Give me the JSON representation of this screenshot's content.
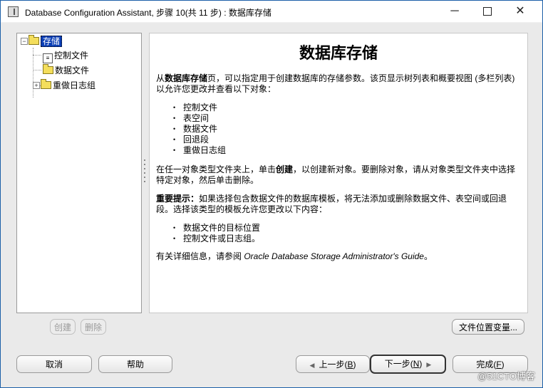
{
  "window": {
    "title": "Database Configuration Assistant, 步骤 10(共 11 步) : 数据库存储",
    "minimize_glyph": "─",
    "close_glyph": "✕"
  },
  "tree": {
    "root": "存储",
    "items": [
      "控制文件",
      "数据文件",
      "重做日志组"
    ]
  },
  "info": {
    "heading": "数据库存储",
    "p1_prefix": "从",
    "p1_bold": "数据库存储",
    "p1_rest": "页，可以指定用于创建数据库的存储参数。该页显示树列表和概要视图 (多栏列表) 以允许您更改并查看以下对象：",
    "list1": [
      "控制文件",
      "表空间",
      "数据文件",
      "回退段",
      "重做日志组"
    ],
    "p2_prefix": "在任一对象类型文件夹上，单击",
    "p2_bold": "创建",
    "p2_rest": "，以创建新对象。要删除对象，请从对象类型文件夹中选择特定对象，然后单击删除。",
    "p3_bold": "重要提示：",
    "p3_rest": "如果选择包含数据文件的数据库模板，将无法添加或删除数据文件、表空间或回退段。选择该类型的模板允许您更改以下内容：",
    "list2": [
      "数据文件的目标位置",
      "控制文件或日志组。"
    ],
    "p4_prefix": "有关详细信息，请参阅 ",
    "p4_italic": "Oracle Database Storage Administrator's Guide",
    "p4_suffix": "。"
  },
  "buttons": {
    "create": "创建",
    "delete": "删除",
    "file_location_vars": "文件位置变量...",
    "cancel": "取消",
    "help": "帮助",
    "back": "上一步",
    "back_key": "B",
    "next": "下一步",
    "next_key": "N",
    "finish": "完成",
    "finish_key": "F"
  },
  "watermark": "@51CTO博客"
}
